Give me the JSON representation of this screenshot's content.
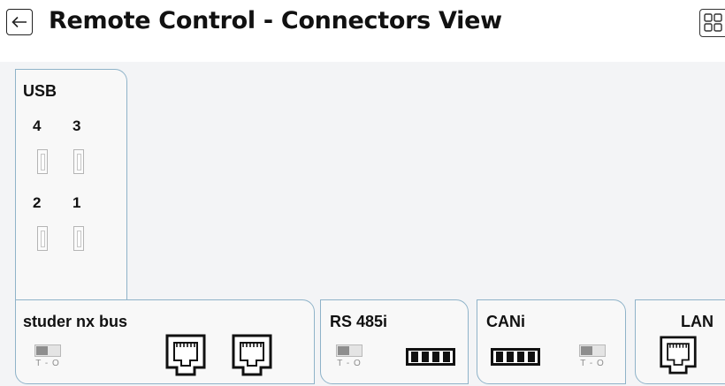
{
  "header": {
    "title": "Remote Control - Connectors View",
    "back_icon": "arrow-left-icon",
    "view_icon": "grid-view-icon"
  },
  "colors": {
    "panel_border": "#8fb3c9",
    "canvas_bg": "#f3f4f6",
    "text": "#111111"
  },
  "usb": {
    "label": "USB",
    "ports": [
      {
        "num": "4"
      },
      {
        "num": "3"
      },
      {
        "num": "2"
      },
      {
        "num": "1"
      }
    ]
  },
  "studer": {
    "label": "studer nx bus",
    "switch_caption": "T - O"
  },
  "rs485": {
    "label": "RS 485i",
    "switch_caption": "T - O"
  },
  "cani": {
    "label": "CANi",
    "switch_caption": "T - O"
  },
  "lan": {
    "label": "LAN"
  }
}
